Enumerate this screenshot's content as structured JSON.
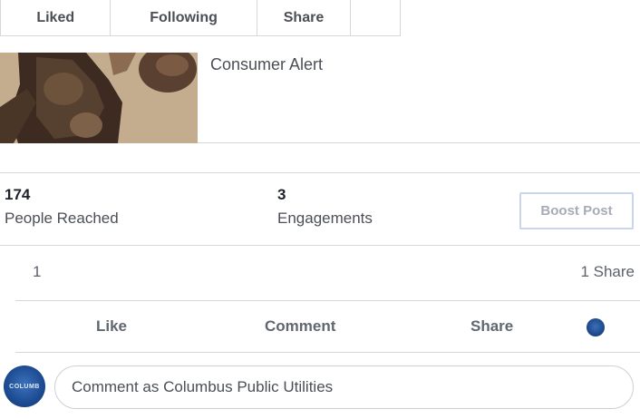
{
  "top_buttons": {
    "liked": "Liked",
    "following": "Following",
    "share": "Share"
  },
  "link_preview": {
    "title": "Consumer Alert"
  },
  "stats": {
    "reach_count": "174",
    "reach_label": "People Reached",
    "engagement_count": "3",
    "engagement_label": "Engagements"
  },
  "boost_button": "Boost Post",
  "reaction_count": "1",
  "share_count": "1 Share",
  "actions": {
    "like": "Like",
    "comment": "Comment",
    "share": "Share"
  },
  "composer": {
    "placeholder": "Comment as Columbus Public Utilities",
    "avatar_text": "COLUMB"
  }
}
